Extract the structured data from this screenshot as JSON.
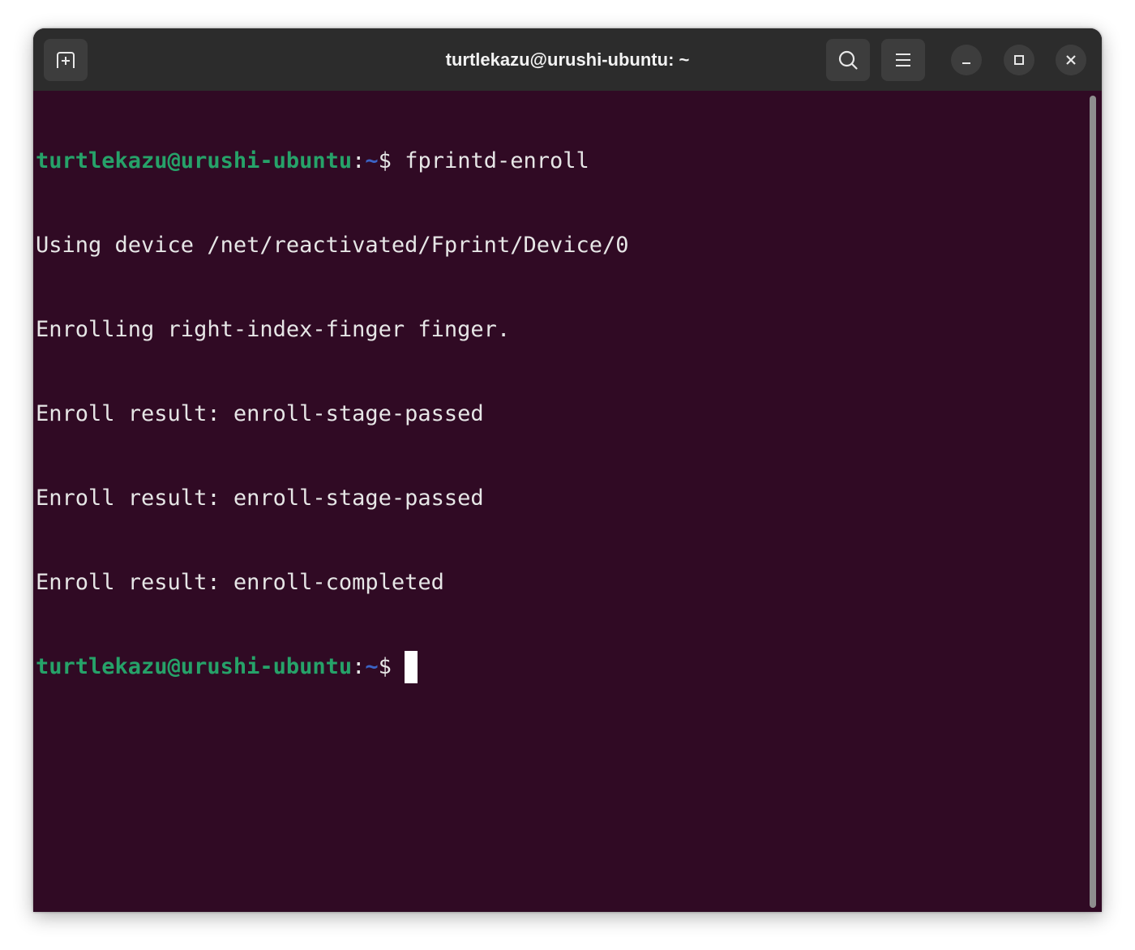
{
  "window": {
    "title": "turtlekazu@urushi-ubuntu: ~"
  },
  "titlebar": {
    "new_tab_icon": "new-tab-icon",
    "search_icon": "search-icon",
    "menu_icon": "hamburger-menu-icon",
    "minimize_icon": "minimize-icon",
    "maximize_icon": "maximize-icon",
    "close_icon": "close-icon"
  },
  "terminal": {
    "prompt": {
      "user_host": "turtlekazu@urushi-ubuntu",
      "colon": ":",
      "path": "~",
      "dollar": "$ "
    },
    "command": "fprintd-enroll",
    "output": [
      "Using device /net/reactivated/Fprint/Device/0",
      "Enrolling right-index-finger finger.",
      "Enroll result: enroll-stage-passed",
      "Enroll result: enroll-stage-passed",
      "Enroll result: enroll-completed"
    ]
  },
  "colors": {
    "background": "#300a24",
    "titlebar": "#2c2c2c",
    "prompt_user": "#26a269",
    "prompt_path": "#3b63c4",
    "text": "#e6e6e6"
  }
}
